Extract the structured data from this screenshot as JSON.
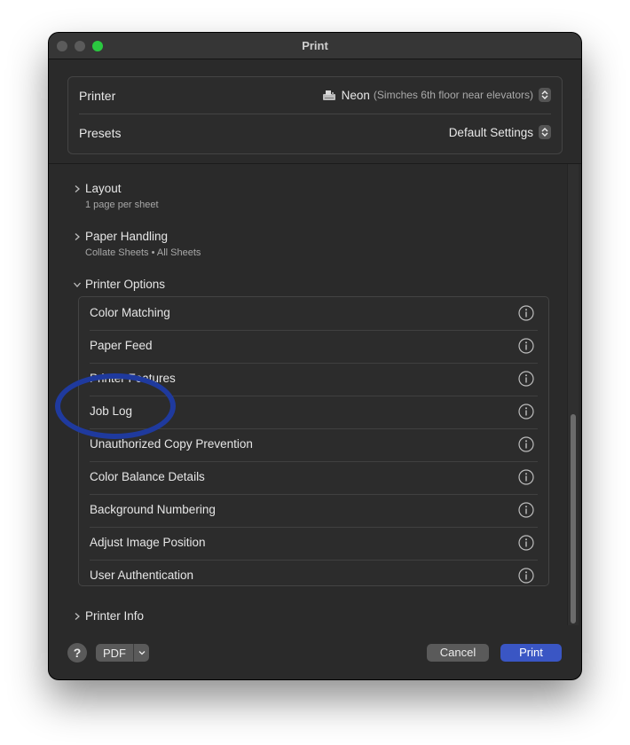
{
  "window": {
    "title": "Print"
  },
  "printer": {
    "label": "Printer",
    "name": "Neon",
    "location": "(Simches 6th floor near elevators)"
  },
  "presets": {
    "label": "Presets",
    "value": "Default Settings"
  },
  "sections": {
    "layout": {
      "title": "Layout",
      "subtitle": "1 page per sheet",
      "expanded": false
    },
    "paper_handling": {
      "title": "Paper Handling",
      "subtitle": "Collate Sheets • All Sheets",
      "expanded": false
    },
    "printer_options": {
      "title": "Printer Options",
      "expanded": true
    },
    "printer_info": {
      "title": "Printer Info",
      "expanded": false
    }
  },
  "printer_options": {
    "items": [
      {
        "label": "Color Matching"
      },
      {
        "label": "Paper Feed"
      },
      {
        "label": "Printer Features"
      },
      {
        "label": "Job Log"
      },
      {
        "label": "Unauthorized Copy Prevention"
      },
      {
        "label": "Color Balance Details"
      },
      {
        "label": "Background Numbering"
      },
      {
        "label": "Adjust Image Position"
      },
      {
        "label": "User Authentication"
      }
    ]
  },
  "footer": {
    "help_label": "?",
    "pdf_label": "PDF",
    "cancel_label": "Cancel",
    "print_label": "Print"
  },
  "colors": {
    "window_bg": "#2a2a2a",
    "accent": "#3a56c4",
    "annotation_circle": "#1f3a9e",
    "zoom_button": "#2ac840"
  },
  "icons": {
    "printer": "printer-icon",
    "stepper": "up-down-stepper-icon",
    "chevron": "chevron-icon",
    "info": "info-icon"
  }
}
